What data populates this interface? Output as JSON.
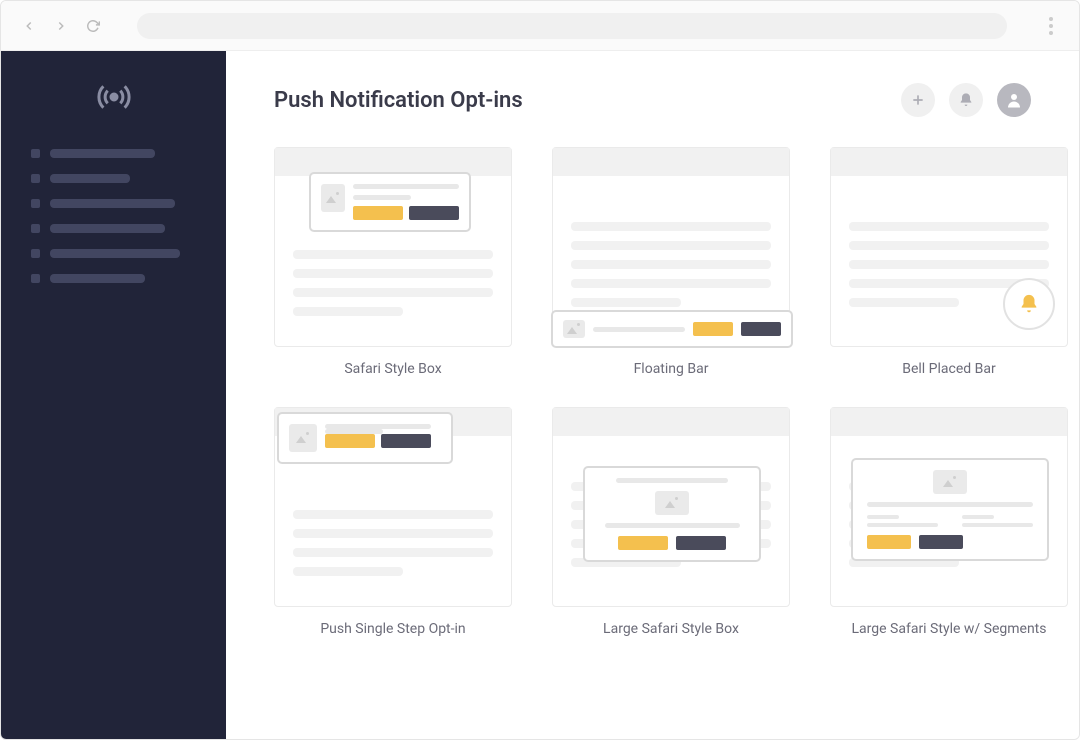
{
  "page": {
    "title": "Push Notification Opt-ins"
  },
  "cards": [
    {
      "label": "Safari Style Box"
    },
    {
      "label": "Floating Bar"
    },
    {
      "label": "Bell Placed Bar"
    },
    {
      "label": "Push Single Step Opt-in"
    },
    {
      "label": "Large Safari Style Box"
    },
    {
      "label": "Large Safari Style w/ Segments"
    }
  ],
  "colors": {
    "sidebar_bg": "#212439",
    "accent_yellow": "#f4c04e",
    "accent_dark": "#4a4b5b"
  }
}
